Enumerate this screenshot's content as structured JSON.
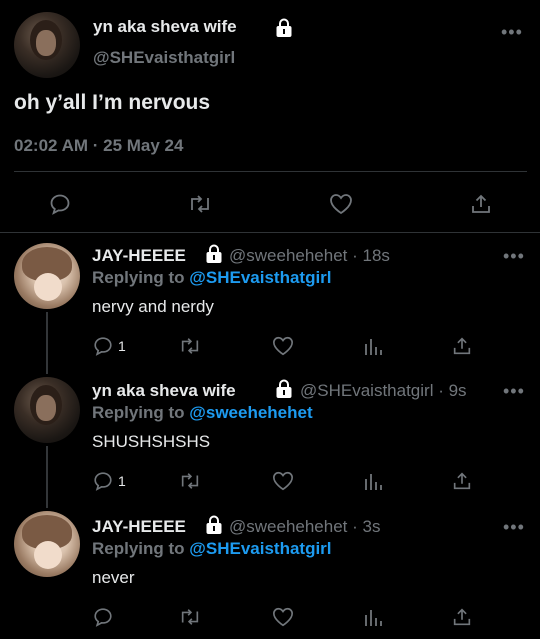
{
  "main_tweet": {
    "display_name": "yn aka sheva wife",
    "handle": "@SHEvaisthatgirl",
    "text": "oh y’all I’m nervous",
    "timestamp": "02:02 AM · 25 May 24"
  },
  "replies": [
    {
      "display_name": "JAY-HEEEE",
      "handle_time": "@sweehehehet · 18s",
      "replying_prefix": "Replying to",
      "replying_to": "@SHEvaisthatgirl",
      "text": "nervy and nerdy",
      "reply_count": "1"
    },
    {
      "display_name": "yn aka sheva wife",
      "handle_time": "@SHEvaisthatgirl · 9s",
      "replying_prefix": "Replying to",
      "replying_to": "@sweehehehet",
      "text": "SHUSHSHSHS",
      "reply_count": "1"
    },
    {
      "display_name": "JAY-HEEEE",
      "handle_time": "@sweehehehet · 3s",
      "replying_prefix": "Replying to",
      "replying_to": "@SHEvaisthatgirl",
      "text": "never",
      "reply_count": ""
    }
  ],
  "icons": {
    "reply": "reply-icon",
    "retweet": "retweet-icon",
    "like": "like-icon",
    "views": "views-icon",
    "share": "share-icon",
    "lock": "lock-icon",
    "more": "more-icon"
  },
  "colors": {
    "background": "#000000",
    "text": "#e7e9ea",
    "muted": "#71767b",
    "link": "#1d9bf0"
  }
}
